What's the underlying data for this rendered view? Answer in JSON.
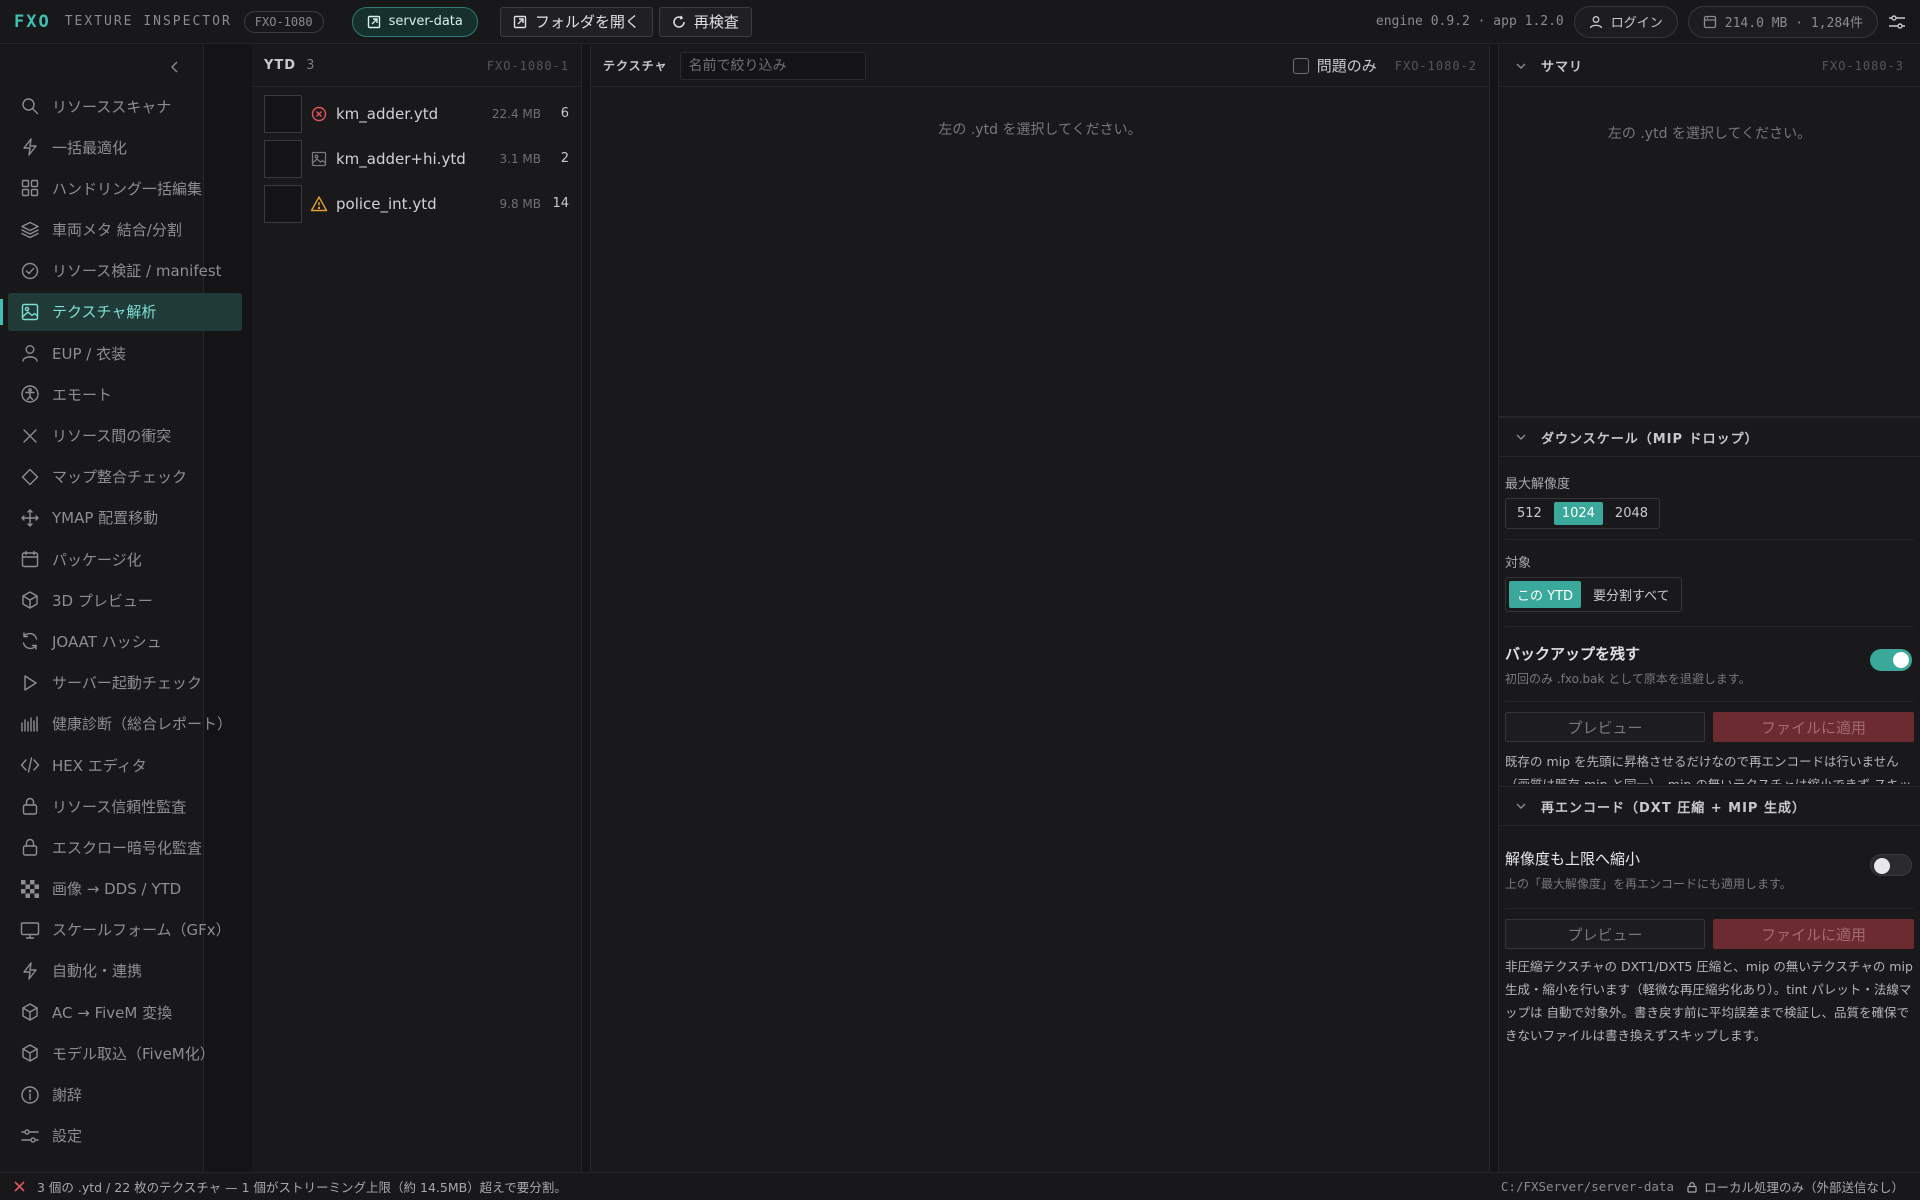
{
  "topbar": {
    "brand": "FXO",
    "app_title": "TEXTURE INSPECTOR",
    "build_code": "FXO-1080",
    "server_chip": "server-data",
    "open_folder": "フォルダを開く",
    "rescan": "再検査",
    "version": "engine 0.9.2 · app 1.2.0",
    "login": "ログイン",
    "storage": "214.0 MB · 1,284件"
  },
  "sidebar": {
    "items": [
      {
        "label": "リソーススキャナ",
        "icon": "search-icon"
      },
      {
        "label": "一括最適化",
        "icon": "bolt-icon"
      },
      {
        "label": "ハンドリング一括編集",
        "icon": "grid-icon"
      },
      {
        "label": "車両メタ 結合/分割",
        "icon": "layers-icon"
      },
      {
        "label": "リソース検証 / manifest",
        "icon": "check-circle-icon"
      },
      {
        "label": "テクスチャ解析",
        "icon": "image-icon",
        "active": true
      },
      {
        "label": "EUP / 衣装",
        "icon": "user-icon"
      },
      {
        "label": "エモート",
        "icon": "person-circle-icon"
      },
      {
        "label": "リソース間の衝突",
        "icon": "x-icon"
      },
      {
        "label": "マップ整合チェック",
        "icon": "diamond-icon"
      },
      {
        "label": "YMAP 配置移動",
        "icon": "move-icon"
      },
      {
        "label": "パッケージ化",
        "icon": "package-icon"
      },
      {
        "label": "3D プレビュー",
        "icon": "cube-icon"
      },
      {
        "label": "JOAAT ハッシュ",
        "icon": "refresh-icon"
      },
      {
        "label": "サーバー起動チェック",
        "icon": "play-icon"
      },
      {
        "label": "健康診断（総合レポート）",
        "icon": "bars-icon"
      },
      {
        "label": "HEX エディタ",
        "icon": "code-icon"
      },
      {
        "label": "リソース信頼性監査",
        "icon": "lock-icon"
      },
      {
        "label": "エスクロー暗号化監査",
        "icon": "lock-icon"
      },
      {
        "label": "画像 → DDS / YTD",
        "icon": "checker-icon"
      },
      {
        "label": "スケールフォーム（GFx）",
        "icon": "monitor-icon"
      },
      {
        "label": "自動化・連携",
        "icon": "bolt-icon"
      },
      {
        "label": "AC → FiveM 変換",
        "icon": "cube-icon"
      },
      {
        "label": "モデル取込（FiveM化）",
        "icon": "cube-icon"
      },
      {
        "label": "謝辞",
        "icon": "info-icon"
      },
      {
        "label": "設定",
        "icon": "sliders-icon"
      }
    ]
  },
  "ytd_panel": {
    "title": "YTD",
    "count": "3",
    "code": "FXO-1080-1",
    "files": [
      {
        "name": "km_adder.ytd",
        "size": "22.4 MB",
        "count": "6",
        "status": "error",
        "status_color": "#e0555b"
      },
      {
        "name": "km_adder+hi.ytd",
        "size": "3.1 MB",
        "count": "2",
        "status": "image",
        "status_color": "#77777d"
      },
      {
        "name": "police_int.ytd",
        "size": "9.8 MB",
        "count": "14",
        "status": "warning",
        "status_color": "#e0a030"
      }
    ]
  },
  "texture_panel": {
    "title": "テクスチャ",
    "filter_placeholder": "名前で絞り込み",
    "issues_only": "問題のみ",
    "code": "FXO-1080-2",
    "empty": "左の .ytd を選択してください。"
  },
  "summary": {
    "title": "サマリ",
    "code": "FXO-1080-3",
    "empty": "左の .ytd を選択してください。"
  },
  "downscale": {
    "title": "ダウンスケール（MIP ドロップ）",
    "max_res_label": "最大解像度",
    "resolutions": [
      "512",
      "1024",
      "2048"
    ],
    "selected_resolution": "1024",
    "target_label": "対象",
    "targets": [
      "この YTD",
      "要分割すべて"
    ],
    "selected_target": "この YTD",
    "backup_title": "バックアップを残す",
    "backup_sub": "初回のみ .fxo.bak として原本を退避します。",
    "backup_on": true,
    "preview": "プレビュー",
    "apply": "ファイルに適用",
    "note": "既存の mip を先頭に昇格させるだけなので再エンコードは行いません（画質は既存 mip と同一）。mip の無いテクスチャは縮小できず スキップされます。"
  },
  "reencode": {
    "title": "再エンコード（DXT 圧縮 + MIP 生成）",
    "shrink_title": "解像度も上限へ縮小",
    "shrink_sub": "上の「最大解像度」を再エンコードにも適用します。",
    "shrink_on": false,
    "preview": "プレビュー",
    "apply": "ファイルに適用",
    "note": "非圧縮テクスチャの DXT1/DXT5 圧縮と、mip の無いテクスチャの mip 生成・縮小を行います（軽微な再圧縮劣化あり）。tint パレット・法線マップは 自動で対象外。書き戻す前に平均誤差まで検証し、品質を確保できないファイルは書き換えずスキップします。"
  },
  "statusbar": {
    "message": "3 個の .ytd / 22 枚のテクスチャ — 1 個がストリーミング上限（約 14.5MB）超えで要分割。",
    "path": "C:/FXServer/server-data",
    "local": "ローカル処理のみ（外部送信なし）"
  },
  "colors": {
    "accent": "#3fc1b2",
    "error": "#e0555b",
    "warning": "#e0a030",
    "apply_button": "#6b2b31"
  }
}
